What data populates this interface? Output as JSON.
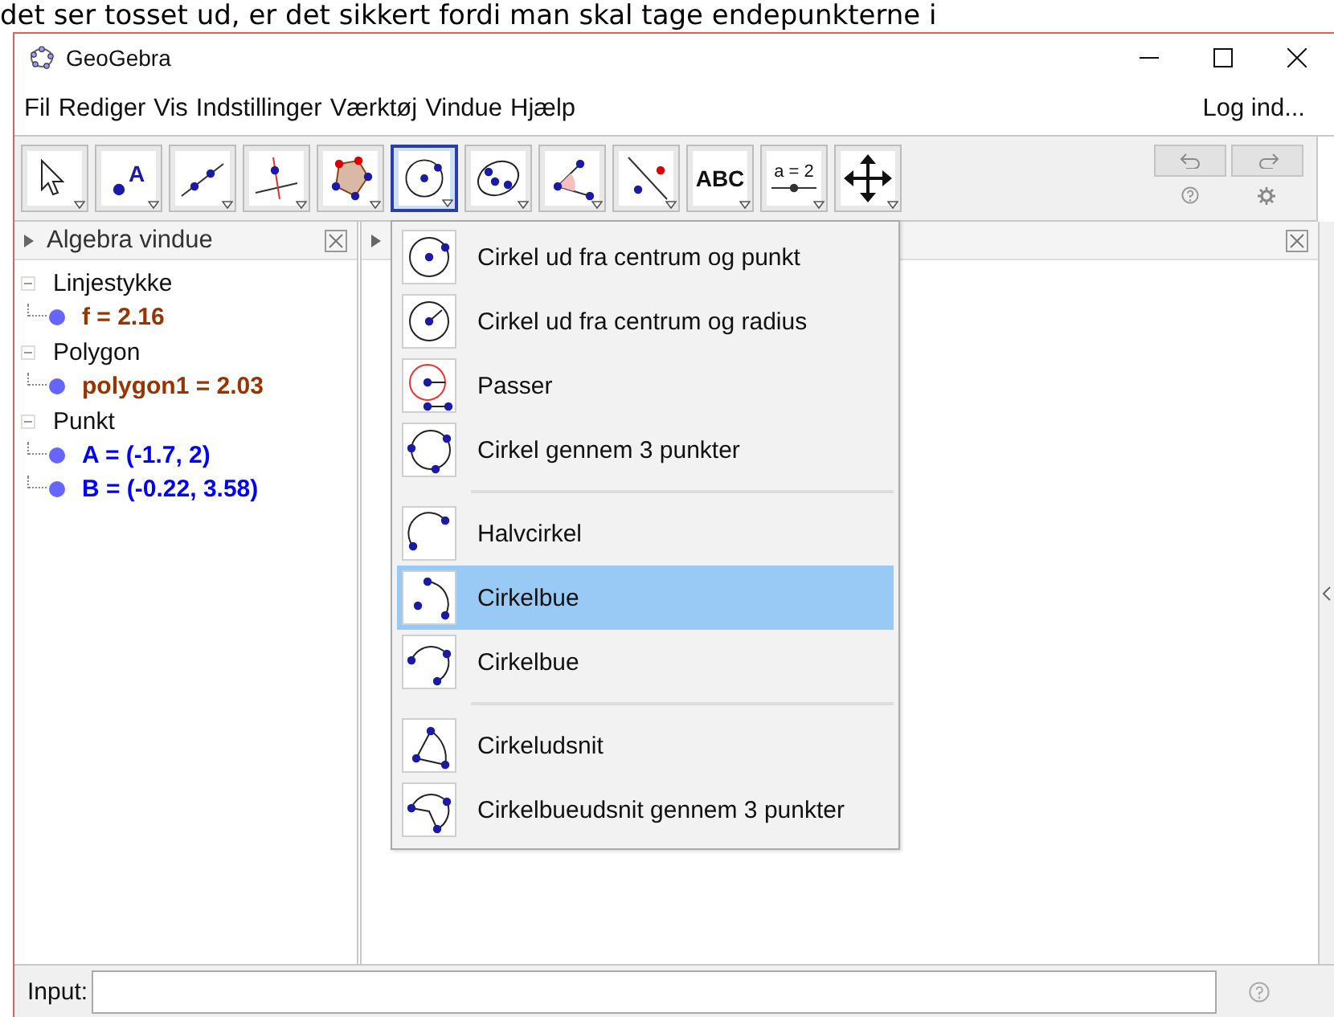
{
  "background_text": "det ser tosset ud, er det sikkert fordi man skal tage endepunkterne i",
  "window": {
    "title": "GeoGebra"
  },
  "menu_bar": {
    "items": [
      "Fil",
      "Rediger",
      "Vis",
      "Indstillinger",
      "Værktøj",
      "Vindue",
      "Hjælp"
    ],
    "login": "Log ind..."
  },
  "toolbar": {
    "tools": [
      {
        "kind": "icon",
        "selected": false
      },
      {
        "kind": "point",
        "selected": false,
        "label": "A"
      },
      {
        "kind": "icon",
        "selected": false
      },
      {
        "kind": "icon",
        "selected": false
      },
      {
        "kind": "icon",
        "selected": false
      },
      {
        "kind": "icon",
        "selected": true
      },
      {
        "kind": "icon",
        "selected": false
      },
      {
        "kind": "icon",
        "selected": false
      },
      {
        "kind": "icon",
        "selected": false
      },
      {
        "kind": "text",
        "selected": false,
        "label": "ABC"
      },
      {
        "kind": "slider",
        "selected": false,
        "label": "a = 2"
      },
      {
        "kind": "icon",
        "selected": false
      }
    ],
    "undo": {
      "disabled": true
    },
    "redo": {
      "disabled": true
    }
  },
  "algebra": {
    "title": "Algebra vindue",
    "groups": [
      {
        "name": "Linjestykke",
        "expanded": true,
        "children": [
          {
            "text": "f = 2.16",
            "color": "#993300"
          }
        ]
      },
      {
        "name": "Polygon",
        "expanded": true,
        "children": [
          {
            "text": "polygon1 = 2.03",
            "color": "#993300"
          }
        ]
      },
      {
        "name": "Punkt",
        "expanded": true,
        "children": [
          {
            "text": "A = (-1.7, 2)",
            "color": "#0000ff"
          },
          {
            "text": "B = (-0.22, 3.58)",
            "color": "#0000ff"
          }
        ]
      }
    ]
  },
  "tool_menu": {
    "groups": [
      [
        {
          "label": "Cirkel ud fra centrum og punkt",
          "selected": false
        },
        {
          "label": "Cirkel ud fra centrum og radius",
          "selected": false
        },
        {
          "label": "Passer",
          "selected": false
        },
        {
          "label": "Cirkel gennem 3 punkter",
          "selected": false
        }
      ],
      [
        {
          "label": "Halvcirkel",
          "selected": false
        },
        {
          "label": "Cirkelbue",
          "selected": true
        },
        {
          "label": "Cirkelbue",
          "selected": false
        }
      ],
      [
        {
          "label": "Cirkeludsnit",
          "selected": false
        },
        {
          "label": "Cirkelbueudsnit gennem 3 punkter",
          "selected": false
        }
      ]
    ]
  },
  "input_bar": {
    "label": "Input:"
  }
}
